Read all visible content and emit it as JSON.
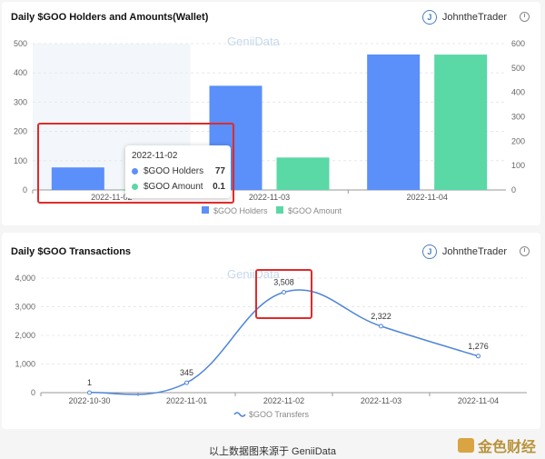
{
  "charts_top": {
    "title": "Daily $GOO Holders and Amounts(Wallet)",
    "user": "JohntheTrader",
    "avatar_letter": "J",
    "watermark": "GeniiData",
    "legend": [
      "$GOO Holders",
      "$GOO Amount"
    ],
    "tooltip": {
      "date": "2022-11-02",
      "rows": [
        {
          "label": "$GOO Holders",
          "value": "77"
        },
        {
          "label": "$GOO Amount",
          "value": "0.1"
        }
      ]
    }
  },
  "charts_bottom": {
    "title": "Daily $GOO Transactions",
    "user": "JohntheTrader",
    "avatar_letter": "J",
    "watermark": "GeniiData",
    "legend": [
      "$GOO Transfers"
    ]
  },
  "footer": {
    "caption": "以上数据图来源于 GeniiData",
    "brand": "金色财经"
  },
  "colors": {
    "holders": "#5b8ff9",
    "amount": "#5ad8a6",
    "line": "#4e85d9",
    "highlight": "#e02b2b"
  },
  "chart_data": [
    {
      "type": "bar",
      "categories": [
        "2022-11-02",
        "2022-11-03",
        "2022-11-04"
      ],
      "series": [
        {
          "name": "$GOO Holders",
          "values": [
            77,
            356,
            463
          ],
          "axis": "left"
        },
        {
          "name": "$GOO Amount",
          "values": [
            0.1,
            133,
            555
          ],
          "axis": "right"
        }
      ],
      "ylim_left": [
        0,
        500
      ],
      "ylim_right": [
        0,
        600
      ],
      "yticks_left": [
        "0",
        "100",
        "200",
        "300",
        "400",
        "500"
      ],
      "yticks_right": [
        "0",
        "100",
        "200",
        "300",
        "400",
        "500",
        "600"
      ],
      "legend_position": "bottom"
    },
    {
      "type": "line",
      "x": [
        "2022-10-30",
        "2022-11-01",
        "2022-11-02",
        "2022-11-03",
        "2022-11-04"
      ],
      "series": [
        {
          "name": "$GOO Transfers",
          "values": [
            1,
            345,
            3508,
            2322,
            1276
          ]
        }
      ],
      "data_labels": [
        "1",
        "345",
        "3,508",
        "2,322",
        "1,276"
      ],
      "ylim": [
        0,
        4000
      ],
      "yticks": [
        "0",
        "1,000",
        "2,000",
        "3,000",
        "4,000"
      ],
      "legend_position": "bottom"
    }
  ]
}
